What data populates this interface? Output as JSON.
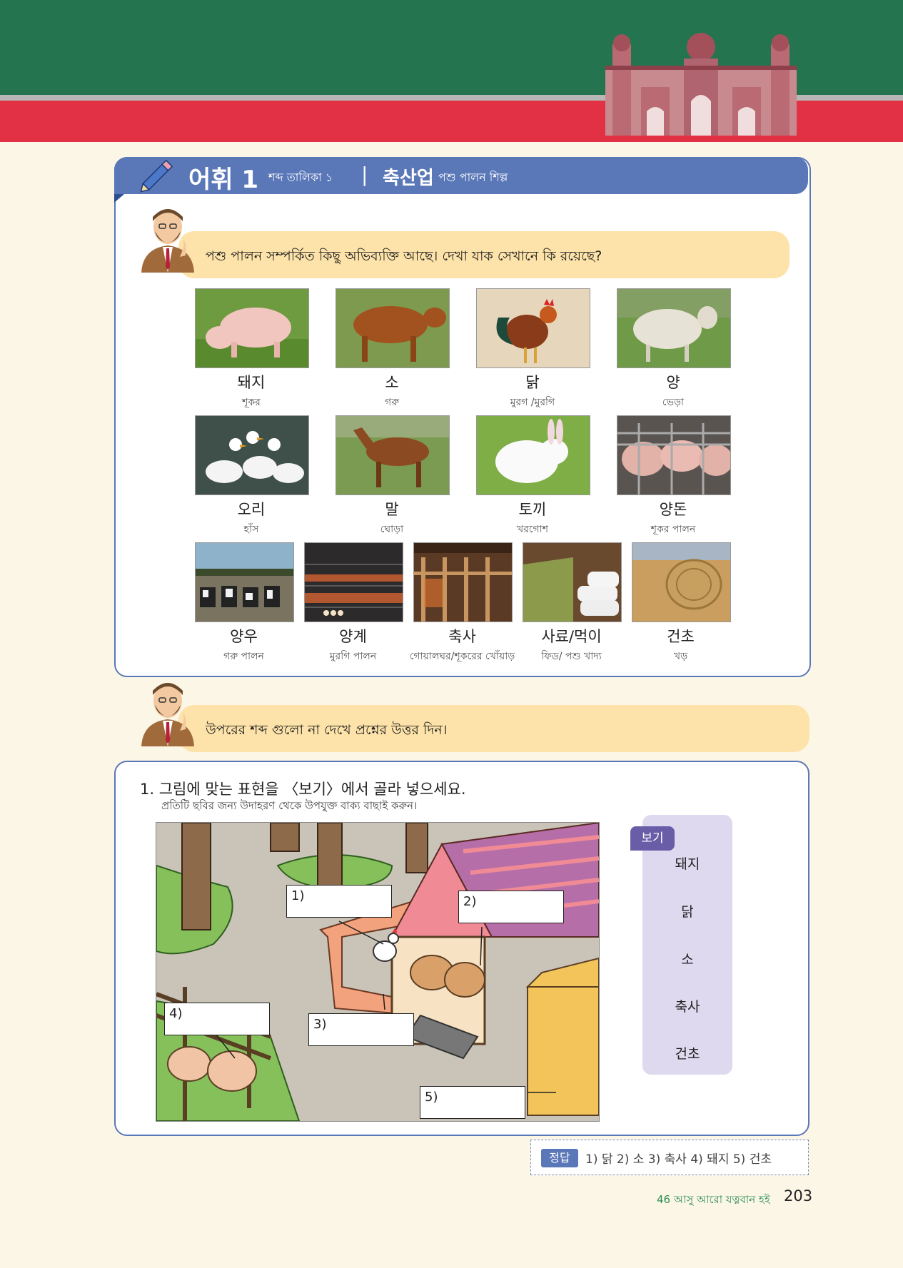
{
  "header": {
    "title_main": "어휘 1",
    "title_sub": "শব্দ তালিকা ১",
    "divider": "|",
    "topic": "축산업",
    "topic_sub": "পশু পালন শিল্প"
  },
  "intro": {
    "prompt": "পশু পালন সম্পর্কিত কিছু অভিব্যক্তি আছে। দেখা যাক সেখানে কি রয়েছে?"
  },
  "vocab": [
    {
      "kor": "돼지",
      "ben": "শূকর",
      "icon": "pig"
    },
    {
      "kor": "소",
      "ben": "গরু",
      "icon": "cow"
    },
    {
      "kor": "닭",
      "ben": "মুরগ /মুরগি",
      "icon": "rooster"
    },
    {
      "kor": "양",
      "ben": "ভেড়া",
      "icon": "sheep"
    },
    {
      "kor": "오리",
      "ben": "হাঁস",
      "icon": "duck"
    },
    {
      "kor": "말",
      "ben": "ঘোড়া",
      "icon": "horse"
    },
    {
      "kor": "토끼",
      "ben": "খরগোশ",
      "icon": "rabbit"
    },
    {
      "kor": "양돈",
      "ben": "শূকর পালন",
      "icon": "pig-farm"
    },
    {
      "kor": "양우",
      "ben": "গরু পালন",
      "icon": "cattle-farm"
    },
    {
      "kor": "양계",
      "ben": "মুরগি পালন",
      "icon": "poultry-farm"
    },
    {
      "kor": "축사",
      "ben": "গোয়ালঘর/শূকরের খোঁয়াড়",
      "icon": "barn"
    },
    {
      "kor": "사료/먹이",
      "ben": "ফিড/ পশু খাদ্য",
      "icon": "feed"
    },
    {
      "kor": "건초",
      "ben": "খড়",
      "icon": "hay"
    }
  ],
  "instruction": {
    "text": "উপরের শব্দ গুলো না দেখে প্রশ্নের উত্তর দিন।"
  },
  "question": {
    "title": "1. 그림에 맞는 표현을 〈보기〉에서 골라 넣으세요.",
    "subtitle": "প্রতিটি ছবির জন্য উদাহরণ থেকে উপযুক্ত বাক্য বাছাই করুন।",
    "blanks": [
      "1)",
      "2)",
      "3)",
      "4)",
      "5)"
    ]
  },
  "bogi": {
    "label": "보기",
    "words": [
      "돼지",
      "닭",
      "소",
      "축사",
      "건초"
    ]
  },
  "answer": {
    "label": "정답",
    "text": "1) 닭   2) 소   3) 축사   4) 돼지   5) 건초"
  },
  "footer": {
    "book": "46 আসু আরো যত্নবান হই",
    "page": "203"
  },
  "colors": {
    "green": "#257450",
    "red": "#e23145",
    "blue": "#5a77b8",
    "bubble": "#fde3a9"
  }
}
